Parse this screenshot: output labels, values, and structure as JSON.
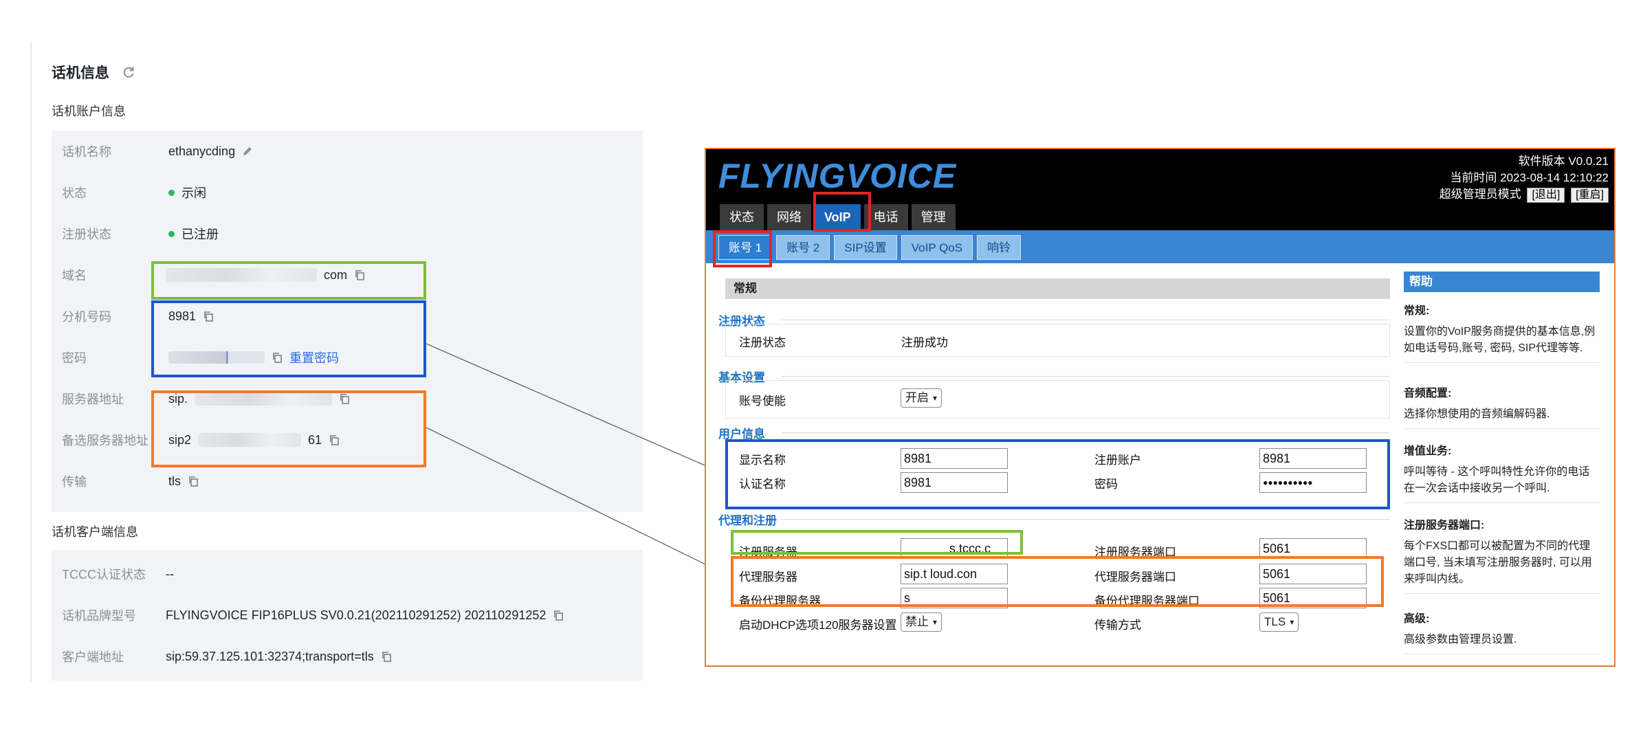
{
  "console": {
    "title": "话机信息",
    "account_section": "话机账户信息",
    "client_section": "话机客户端信息",
    "account_rows": [
      {
        "label": "话机名称",
        "value": "ethanycding"
      },
      {
        "label": "状态",
        "value": "示闲"
      },
      {
        "label": "注册状态",
        "value": "已注册"
      },
      {
        "label": "域名",
        "value": "com"
      },
      {
        "label": "分机号码",
        "value": "8981"
      },
      {
        "label": "密码",
        "value": "",
        "action": "重置密码"
      },
      {
        "label": "服务器地址",
        "value": "sip."
      },
      {
        "label": "备选服务器地址",
        "value": "sip2",
        "suffix": "61"
      },
      {
        "label": "传输",
        "value": "tls"
      }
    ],
    "client_rows": [
      {
        "label": "TCCC认证状态",
        "value": "--"
      },
      {
        "label": "话机品牌型号",
        "value": "FLYINGVOICE FIP16PLUS SV0.0.21(202110291252) 202110291252"
      },
      {
        "label": "客户端地址",
        "value": "sip:59.37.125.101:32374;transport=tls"
      }
    ],
    "status_color": "#2db55d",
    "link_color": "#2b6de5"
  },
  "device": {
    "logo": "FLYINGVOICE",
    "version": "软件版本 V0.0.21",
    "time": "当前时间 2023-08-14 12:10:22",
    "mode": "超级管理员模式",
    "logout": "[退出]",
    "reboot": "[重启]",
    "main_tabs": [
      "状态",
      "网络",
      "VoIP",
      "电话",
      "管理"
    ],
    "sub_tabs": [
      "账号 1",
      "账号 2",
      "SIP设置",
      "VoIP QoS",
      "响铃"
    ],
    "general": "常规",
    "groups": {
      "reg_status": "注册状态",
      "basic": "基本设置",
      "user": "用户信息",
      "proxy": "代理和注册"
    },
    "fields": {
      "reg_status_label": "注册状态",
      "reg_status_value": "注册成功",
      "enable_label": "账号使能",
      "enable_value": "开启",
      "display_name_label": "显示名称",
      "display_name_value": "8981",
      "reg_account_label": "注册账户",
      "reg_account_value": "8981",
      "auth_name_label": "认证名称",
      "auth_name_value": "8981",
      "password_label": "密码",
      "password_value": "●●●●●●●●●●",
      "reg_server_label": "注册服务器",
      "reg_server_value": "s.tccc.c",
      "reg_port_label": "注册服务器端口",
      "reg_port_value": "5061",
      "proxy_label": "代理服务器",
      "proxy_value": "sip.t       loud.con",
      "proxy_port_label": "代理服务器端口",
      "proxy_port_value": "5061",
      "backup_proxy_label": "备份代理服务器",
      "backup_proxy_value": "s",
      "backup_proxy_port_label": "备份代理服务器端口",
      "backup_proxy_port_value": "5061",
      "dhcp_label": "启动DHCP选项120服务器设置",
      "dhcp_value": "禁止",
      "transport_label": "传输方式",
      "transport_value": "TLS"
    },
    "help": {
      "title": "帮助",
      "blocks": [
        {
          "title": "常规:",
          "text": "设置你的VoIP服务商提供的基本信息,例如电话号码,账号, 密码, SIP代理等等."
        },
        {
          "title": "音频配置:",
          "text": "选择你想使用的音频编解码器."
        },
        {
          "title": "增值业务:",
          "text": "呼叫等待 - 这个呼叫特性允许你的电话在一次会话中接收另一个呼叫."
        },
        {
          "title": "注册服务器端口:",
          "text": "每个FXS口都可以被配置为不同的代理端口号, 当未填写注册服务器时, 可以用来呼叫内线。"
        },
        {
          "title": "高级:",
          "text": "高级参数由管理员设置."
        }
      ]
    }
  },
  "annotation_colors": {
    "green": "#7cbf3a",
    "blue": "#1f55c9",
    "orange": "#f07a2a",
    "red": "#e02626"
  }
}
